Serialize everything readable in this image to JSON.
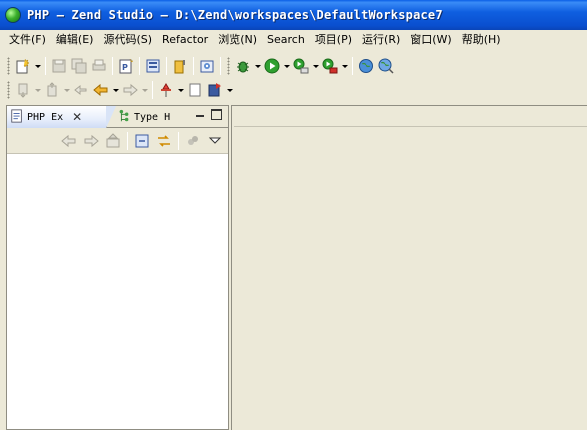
{
  "window": {
    "title": "PHP — Zend Studio — D:\\Zend\\workspaces\\DefaultWorkspace7"
  },
  "menu": [
    {
      "label": "文件(F)"
    },
    {
      "label": "编辑(E)"
    },
    {
      "label": "源代码(S)"
    },
    {
      "label": "Refactor"
    },
    {
      "label": "浏览(N)"
    },
    {
      "label": "Search"
    },
    {
      "label": "项目(P)"
    },
    {
      "label": "运行(R)"
    },
    {
      "label": "窗口(W)"
    },
    {
      "label": "帮助(H)"
    }
  ],
  "views": {
    "tabs": [
      {
        "label": "PHP Ex",
        "active": true,
        "close": "✕"
      },
      {
        "label": "Type H",
        "active": false
      }
    ]
  },
  "colors": {
    "title_bar": "#0a5fe6",
    "chrome": "#ece9d8",
    "border": "#8f8d82",
    "run_green": "#2fa02f",
    "debug_red": "#d0302a"
  }
}
